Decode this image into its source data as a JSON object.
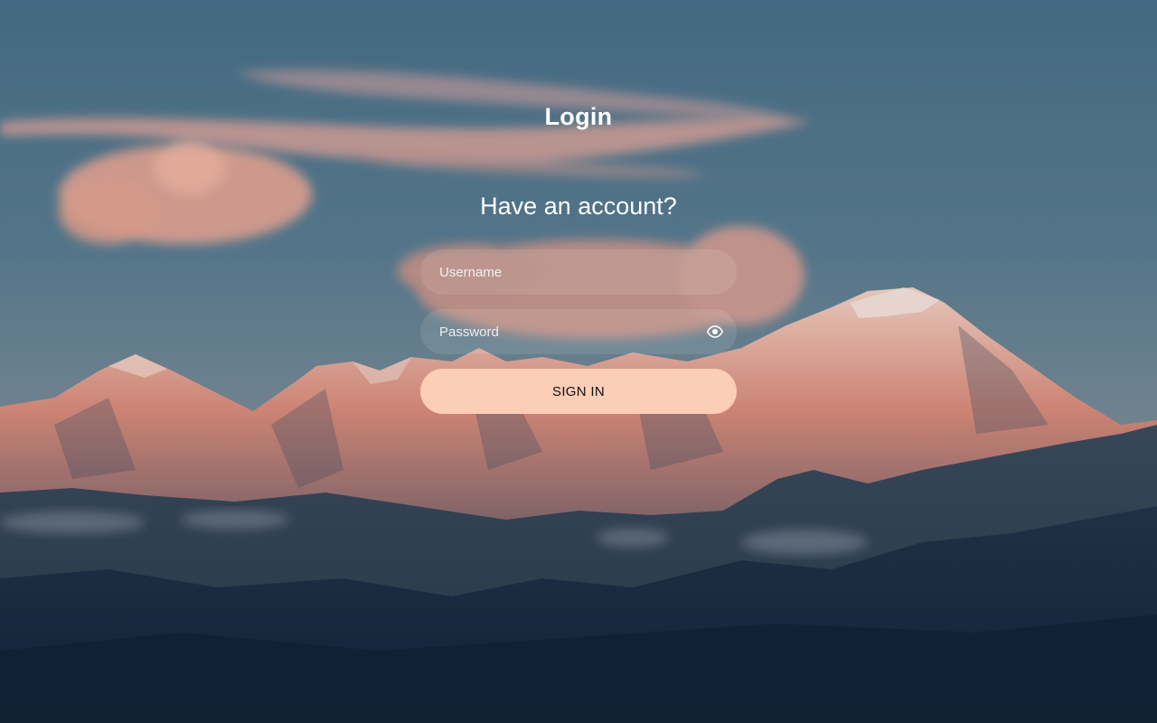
{
  "page": {
    "title": "Login"
  },
  "form": {
    "heading": "Have an account?",
    "username_placeholder": "Username",
    "password_placeholder": "Password",
    "submit_label": "SIGN IN",
    "show_password_icon": "eye-icon"
  },
  "colors": {
    "button_bg": "#fbceb5",
    "text": "#ffffff"
  }
}
